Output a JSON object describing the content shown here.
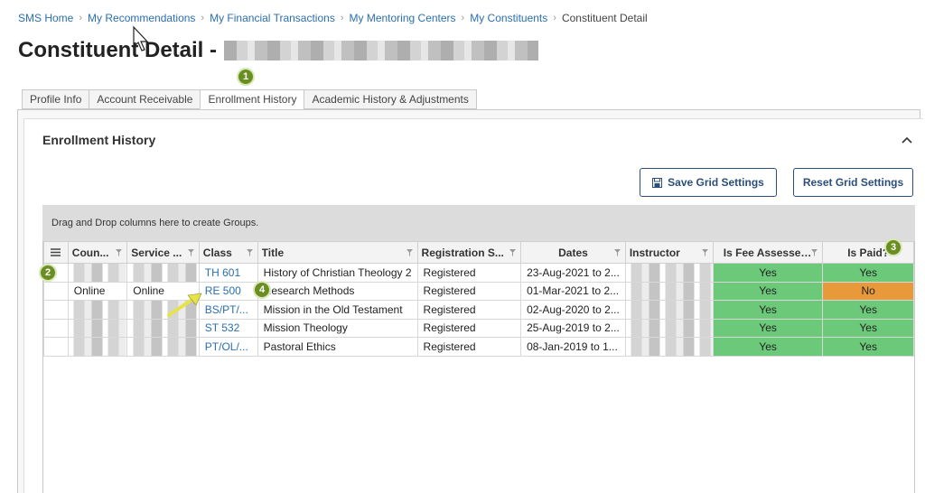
{
  "breadcrumb": {
    "items": [
      "SMS Home",
      "My Recommendations",
      "My Financial Transactions",
      "My Mentoring Centers",
      "My Constituents"
    ],
    "current": "Constituent Detail"
  },
  "page": {
    "title": "Constituent Detail -"
  },
  "tabs": [
    {
      "label": "Profile Info",
      "active": false
    },
    {
      "label": "Account Receivable",
      "active": false
    },
    {
      "label": "Enrollment History",
      "active": true
    },
    {
      "label": "Academic History & Adjustments",
      "active": false
    }
  ],
  "section": {
    "title": "Enrollment History"
  },
  "buttons": {
    "save_grid": "Save Grid Settings",
    "reset_grid": "Reset Grid Settings"
  },
  "group_bar": {
    "text": "Drag and Drop columns here to create Groups."
  },
  "grid": {
    "columns": [
      "Coun...",
      "Service ...",
      "Class",
      "Title",
      "Registration S...",
      "Dates",
      "Instructor",
      "Is Fee Assessed?",
      "Is Paid?"
    ],
    "rows": [
      {
        "county": "",
        "service": "",
        "class": "TH 601",
        "title": "History of Christian Theology 2",
        "registration": "Registered",
        "dates": "23-Aug-2021 to 2...",
        "instructor": "",
        "fee": "Yes",
        "paid": "Yes"
      },
      {
        "county": "Online",
        "service": "Online",
        "class": "RE 500",
        "title": "Research Methods",
        "registration": "Registered",
        "dates": "01-Mar-2021 to 2...",
        "instructor": "",
        "fee": "Yes",
        "paid": "No"
      },
      {
        "county": "",
        "service": "",
        "class": "BS/PT/...",
        "title": "Mission in the Old Testament",
        "registration": "Registered",
        "dates": "02-Aug-2020 to 2...",
        "instructor": "",
        "fee": "Yes",
        "paid": "Yes"
      },
      {
        "county": "",
        "service": "",
        "class": "ST 532",
        "title": "Mission Theology",
        "registration": "Registered",
        "dates": "25-Aug-2019 to 2...",
        "instructor": "",
        "fee": "Yes",
        "paid": "Yes"
      },
      {
        "county": "",
        "service": "",
        "class": "PT/OL/...",
        "title": "Pastoral Ethics",
        "registration": "Registered",
        "dates": "08-Jan-2019 to 1...",
        "instructor": "",
        "fee": "Yes",
        "paid": "Yes"
      }
    ]
  },
  "annotations": [
    "1",
    "2",
    "3",
    "4"
  ],
  "colors": {
    "link": "#2a6fb0",
    "yes": "#6cc97a",
    "no": "#e89a3a",
    "badge": "#6b8e23"
  },
  "icons": [
    "filter-icon",
    "menu-icon",
    "save-icon",
    "chevron-up-icon"
  ]
}
